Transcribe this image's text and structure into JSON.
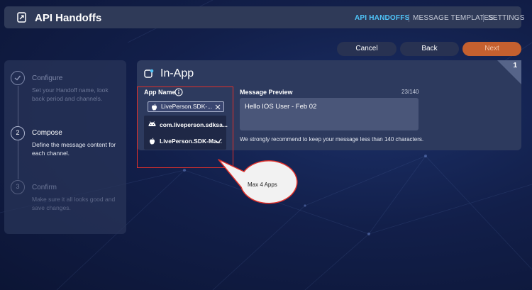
{
  "header": {
    "title": "API Handoffs",
    "nav": [
      "API HANDOFFS",
      "MESSAGE TEMPLATES",
      "SETTINGS"
    ]
  },
  "actions": {
    "cancel": "Cancel",
    "back": "Back",
    "next": "Next"
  },
  "steps": [
    {
      "number": "",
      "title": "Configure",
      "desc": "Set your Handoff name, look back period and channels.",
      "state": "done"
    },
    {
      "number": "2",
      "title": "Compose",
      "desc": "Define the message content for each channel.",
      "state": "active"
    },
    {
      "number": "3",
      "title": "Confirm",
      "desc": "Make sure it all looks good and save changes.",
      "state": "pending"
    }
  ],
  "card": {
    "corner_number": "1",
    "title": "In-App",
    "app_name_label": "App Name",
    "selected_app": "LivePerson.SDK-...",
    "app_options": [
      {
        "label": "com.liveperson.sdksa...",
        "platform": "android-icon",
        "checked": false
      },
      {
        "label": "LivePerson.SDK-Ma...",
        "platform": "apple-icon",
        "checked": true
      }
    ],
    "preview_label": "Message Preview",
    "char_count": "23/140",
    "preview_text": "Hello IOS User - Feb 02",
    "hint": "We strongly recommend to keep your message less than 140 characters."
  },
  "annotation": {
    "callout_text": "Max 4 Apps",
    "color": "#e0302a"
  },
  "colors": {
    "accent": "#4fc3f7",
    "next_button": "#c5602f"
  }
}
